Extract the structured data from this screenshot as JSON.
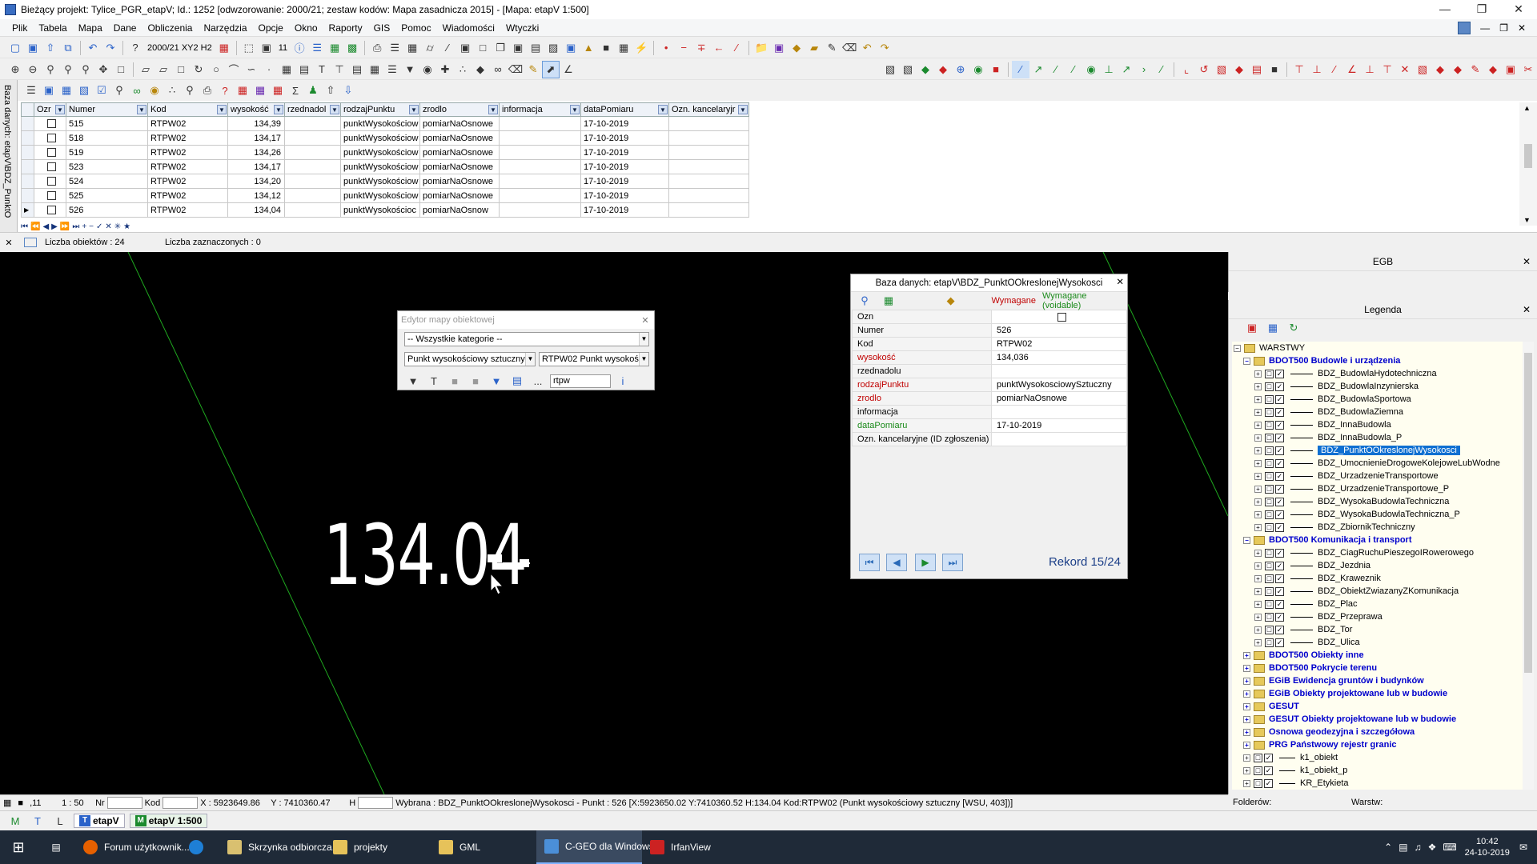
{
  "window": {
    "title": "Bieżący projekt: Tylice_PGR_etapV; Id.: 1252 [odwzorowanie: 2000/21; zestaw kodów: Mapa zasadnicza 2015] - [Mapa: etapV  1:500]"
  },
  "menu": [
    "Plik",
    "Tabela",
    "Mapa",
    "Dane",
    "Obliczenia",
    "Narzędzia",
    "Opcje",
    "Okno",
    "Raporty",
    "GIS",
    "Pomoc",
    "Wiadomości",
    "Wtyczki"
  ],
  "toolbar": {
    "coord_system": "2000/21 XY2 H2",
    "layer_count": "11"
  },
  "db_table": {
    "side_title": "Baza danych: etapV\\BDZ_PunktO",
    "columns": [
      "Ozr",
      "Numer",
      "Kod",
      "wysokość",
      "rzednadol",
      "rodzajPunktu",
      "zrodlo",
      "informacja",
      "dataPomiaru",
      "Ozn. kancelaryjr"
    ],
    "rows": [
      {
        "numer": "515",
        "kod": "RTPW02",
        "wys": "134,39",
        "rodzaj": "punktWysokościow",
        "zrodlo": "pomiarNaOsnowe",
        "data": "17-10-2019"
      },
      {
        "numer": "518",
        "kod": "RTPW02",
        "wys": "134,17",
        "rodzaj": "punktWysokościow",
        "zrodlo": "pomiarNaOsnowe",
        "data": "17-10-2019"
      },
      {
        "numer": "519",
        "kod": "RTPW02",
        "wys": "134,26",
        "rodzaj": "punktWysokościow",
        "zrodlo": "pomiarNaOsnowe",
        "data": "17-10-2019"
      },
      {
        "numer": "523",
        "kod": "RTPW02",
        "wys": "134,17",
        "rodzaj": "punktWysokościow",
        "zrodlo": "pomiarNaOsnowe",
        "data": "17-10-2019"
      },
      {
        "numer": "524",
        "kod": "RTPW02",
        "wys": "134,20",
        "rodzaj": "punktWysokościow",
        "zrodlo": "pomiarNaOsnowe",
        "data": "17-10-2019"
      },
      {
        "numer": "525",
        "kod": "RTPW02",
        "wys": "134,12",
        "rodzaj": "punktWysokościow",
        "zrodlo": "pomiarNaOsnowe",
        "data": "17-10-2019"
      },
      {
        "numer": "526",
        "kod": "RTPW02",
        "wys": "134,04",
        "rodzaj": "punktWysokościoc",
        "zrodlo": "pomiarNaOsnow",
        "data": "17-10-2019"
      }
    ],
    "count_label": "Liczba obiektów : 24",
    "selected_label": "Liczba zaznaczonych : 0"
  },
  "map": {
    "label": "134.04"
  },
  "editor": {
    "title": "Edytor mapy obiektowej",
    "category": "-- Wszystkie kategorie --",
    "object_type": "Punkt wysokościowy sztuczny",
    "code": "RTPW02 Punkt wysokoś",
    "search": "rtpw",
    "dots": "..."
  },
  "record": {
    "title": "Baza danych: etapV\\BDZ_PunktOOkreslonejWysokosci",
    "required": "Wymagane",
    "required_voidable": "Wymagane (voidable)",
    "fields": [
      {
        "k": "Ozn",
        "v": "",
        "cls": ""
      },
      {
        "k": "Numer",
        "v": "526",
        "cls": ""
      },
      {
        "k": "Kod",
        "v": "RTPW02",
        "cls": ""
      },
      {
        "k": "wysokość",
        "v": "134,036",
        "cls": "req"
      },
      {
        "k": "rzednadolu",
        "v": "",
        "cls": ""
      },
      {
        "k": "rodzajPunktu",
        "v": "punktWysokosciowySztuczny",
        "cls": "req"
      },
      {
        "k": "zrodlo",
        "v": "pomiarNaOsnowe",
        "cls": "req"
      },
      {
        "k": "informacja",
        "v": "",
        "cls": ""
      },
      {
        "k": "dataPomiaru",
        "v": "17-10-2019",
        "cls": "reqv"
      },
      {
        "k": "Ozn. kancelaryjne (ID zgłoszenia)",
        "v": "",
        "cls": ""
      }
    ],
    "record_label": "Rekord 15/24"
  },
  "egb": {
    "title": "EGB"
  },
  "legend": {
    "title": "Legenda",
    "root": "WARSTWY",
    "groups": [
      {
        "name": "BDOT500 Budowle i urządzenia",
        "items": [
          "BDZ_BudowlaHydotechniczna",
          "BDZ_BudowlaInzynierska",
          "BDZ_BudowlaSportowa",
          "BDZ_BudowlaZiemna",
          "BDZ_InnaBudowla",
          "BDZ_InnaBudowla_P",
          "BDZ_PunktOOkreslonejWysokosci",
          "BDZ_UmocnienieDrogoweKolejoweLubWodne",
          "BDZ_UrzadzenieTransportowe",
          "BDZ_UrzadzenieTransportowe_P",
          "BDZ_WysokaBudowlaTechniczna",
          "BDZ_WysokaBudowlaTechniczna_P",
          "BDZ_ZbiornikTechniczny"
        ]
      },
      {
        "name": "BDOT500 Komunikacja i transport",
        "items": [
          "BDZ_CiagRuchuPieszegoIRowerowego",
          "BDZ_Jezdnia",
          "BDZ_Kraweznik",
          "BDZ_ObiektZwiazanyZKomunikacja",
          "BDZ_Plac",
          "BDZ_Przeprawa",
          "BDZ_Tor",
          "BDZ_Ulica"
        ]
      },
      {
        "name": "BDOT500 Obiekty inne",
        "items": []
      },
      {
        "name": "BDOT500 Pokrycie terenu",
        "items": []
      },
      {
        "name": "EGiB Ewidencja gruntów i budynków",
        "items": []
      },
      {
        "name": "EGiB Obiekty projektowane lub w budowie",
        "items": []
      },
      {
        "name": "GESUT",
        "items": []
      },
      {
        "name": "GESUT Obiekty projektowane lub w budowie",
        "items": []
      },
      {
        "name": "Osnowa geodezyjna i szczegółowa",
        "items": []
      },
      {
        "name": "PRG Państwowy rejestr granic",
        "items": []
      }
    ],
    "tail": [
      "k1_obiekt",
      "k1_obiekt_p",
      "KR_Etykieta"
    ],
    "selected": "BDZ_PunktOOkreslonejWysokosci",
    "footer_left": "Folderów:",
    "footer_right": "Warstw:"
  },
  "status": {
    "scale_prefix": ",11",
    "scale": "1 : 50",
    "nr": "Nr",
    "kod": "Kod",
    "x": "X : 5923649.86",
    "y": "Y : 7410360.47",
    "h": "H",
    "info": "Wybrana : BDZ_PunktOOkreslonejWysokosci  -  Punkt : 526 [X:5923650.02 Y:7410360.52 H:134.04 Kod:RTPW02 (Punkt wysokościowy sztuczny [WSU, 403])]"
  },
  "map_tabs": [
    "etapV",
    "etapV 1:500"
  ],
  "taskbar": {
    "apps": [
      {
        "label": "Forum użytkownik...",
        "color": "#e66000"
      },
      {
        "label": "",
        "color": "#1e7fd6"
      },
      {
        "label": "Skrzynka odbiorcza...",
        "color": "#d9c070"
      },
      {
        "label": "projekty",
        "color": "#e6c25a"
      },
      {
        "label": "GML",
        "color": "#e6c25a"
      },
      {
        "label": "C-GEO dla Windows",
        "color": "#4b8fd8"
      },
      {
        "label": "IrfanView",
        "color": "#cc2222"
      }
    ],
    "time": "10:42",
    "date": "24-10-2019"
  }
}
